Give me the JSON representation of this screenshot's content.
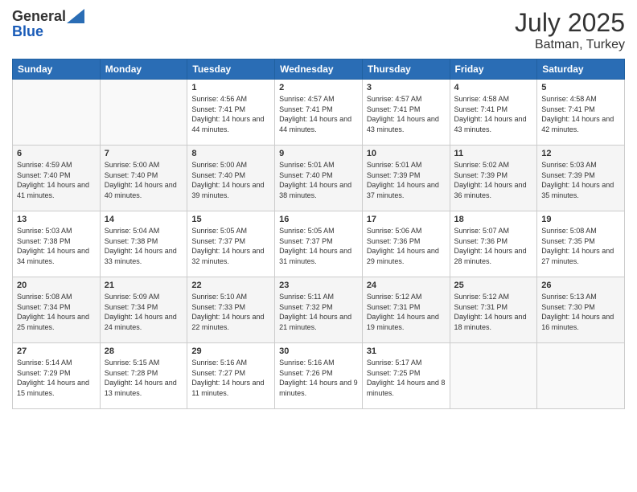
{
  "header": {
    "month_title": "July 2025",
    "location": "Batman, Turkey",
    "logo_general": "General",
    "logo_blue": "Blue"
  },
  "calendar": {
    "days": [
      "Sunday",
      "Monday",
      "Tuesday",
      "Wednesday",
      "Thursday",
      "Friday",
      "Saturday"
    ],
    "weeks": [
      [
        {
          "day": "",
          "info": ""
        },
        {
          "day": "",
          "info": ""
        },
        {
          "day": "1",
          "info": "Sunrise: 4:56 AM\nSunset: 7:41 PM\nDaylight: 14 hours and 44 minutes."
        },
        {
          "day": "2",
          "info": "Sunrise: 4:57 AM\nSunset: 7:41 PM\nDaylight: 14 hours and 44 minutes."
        },
        {
          "day": "3",
          "info": "Sunrise: 4:57 AM\nSunset: 7:41 PM\nDaylight: 14 hours and 43 minutes."
        },
        {
          "day": "4",
          "info": "Sunrise: 4:58 AM\nSunset: 7:41 PM\nDaylight: 14 hours and 43 minutes."
        },
        {
          "day": "5",
          "info": "Sunrise: 4:58 AM\nSunset: 7:41 PM\nDaylight: 14 hours and 42 minutes."
        }
      ],
      [
        {
          "day": "6",
          "info": "Sunrise: 4:59 AM\nSunset: 7:40 PM\nDaylight: 14 hours and 41 minutes."
        },
        {
          "day": "7",
          "info": "Sunrise: 5:00 AM\nSunset: 7:40 PM\nDaylight: 14 hours and 40 minutes."
        },
        {
          "day": "8",
          "info": "Sunrise: 5:00 AM\nSunset: 7:40 PM\nDaylight: 14 hours and 39 minutes."
        },
        {
          "day": "9",
          "info": "Sunrise: 5:01 AM\nSunset: 7:40 PM\nDaylight: 14 hours and 38 minutes."
        },
        {
          "day": "10",
          "info": "Sunrise: 5:01 AM\nSunset: 7:39 PM\nDaylight: 14 hours and 37 minutes."
        },
        {
          "day": "11",
          "info": "Sunrise: 5:02 AM\nSunset: 7:39 PM\nDaylight: 14 hours and 36 minutes."
        },
        {
          "day": "12",
          "info": "Sunrise: 5:03 AM\nSunset: 7:39 PM\nDaylight: 14 hours and 35 minutes."
        }
      ],
      [
        {
          "day": "13",
          "info": "Sunrise: 5:03 AM\nSunset: 7:38 PM\nDaylight: 14 hours and 34 minutes."
        },
        {
          "day": "14",
          "info": "Sunrise: 5:04 AM\nSunset: 7:38 PM\nDaylight: 14 hours and 33 minutes."
        },
        {
          "day": "15",
          "info": "Sunrise: 5:05 AM\nSunset: 7:37 PM\nDaylight: 14 hours and 32 minutes."
        },
        {
          "day": "16",
          "info": "Sunrise: 5:05 AM\nSunset: 7:37 PM\nDaylight: 14 hours and 31 minutes."
        },
        {
          "day": "17",
          "info": "Sunrise: 5:06 AM\nSunset: 7:36 PM\nDaylight: 14 hours and 29 minutes."
        },
        {
          "day": "18",
          "info": "Sunrise: 5:07 AM\nSunset: 7:36 PM\nDaylight: 14 hours and 28 minutes."
        },
        {
          "day": "19",
          "info": "Sunrise: 5:08 AM\nSunset: 7:35 PM\nDaylight: 14 hours and 27 minutes."
        }
      ],
      [
        {
          "day": "20",
          "info": "Sunrise: 5:08 AM\nSunset: 7:34 PM\nDaylight: 14 hours and 25 minutes."
        },
        {
          "day": "21",
          "info": "Sunrise: 5:09 AM\nSunset: 7:34 PM\nDaylight: 14 hours and 24 minutes."
        },
        {
          "day": "22",
          "info": "Sunrise: 5:10 AM\nSunset: 7:33 PM\nDaylight: 14 hours and 22 minutes."
        },
        {
          "day": "23",
          "info": "Sunrise: 5:11 AM\nSunset: 7:32 PM\nDaylight: 14 hours and 21 minutes."
        },
        {
          "day": "24",
          "info": "Sunrise: 5:12 AM\nSunset: 7:31 PM\nDaylight: 14 hours and 19 minutes."
        },
        {
          "day": "25",
          "info": "Sunrise: 5:12 AM\nSunset: 7:31 PM\nDaylight: 14 hours and 18 minutes."
        },
        {
          "day": "26",
          "info": "Sunrise: 5:13 AM\nSunset: 7:30 PM\nDaylight: 14 hours and 16 minutes."
        }
      ],
      [
        {
          "day": "27",
          "info": "Sunrise: 5:14 AM\nSunset: 7:29 PM\nDaylight: 14 hours and 15 minutes."
        },
        {
          "day": "28",
          "info": "Sunrise: 5:15 AM\nSunset: 7:28 PM\nDaylight: 14 hours and 13 minutes."
        },
        {
          "day": "29",
          "info": "Sunrise: 5:16 AM\nSunset: 7:27 PM\nDaylight: 14 hours and 11 minutes."
        },
        {
          "day": "30",
          "info": "Sunrise: 5:16 AM\nSunset: 7:26 PM\nDaylight: 14 hours and 9 minutes."
        },
        {
          "day": "31",
          "info": "Sunrise: 5:17 AM\nSunset: 7:25 PM\nDaylight: 14 hours and 8 minutes."
        },
        {
          "day": "",
          "info": ""
        },
        {
          "day": "",
          "info": ""
        }
      ]
    ]
  }
}
